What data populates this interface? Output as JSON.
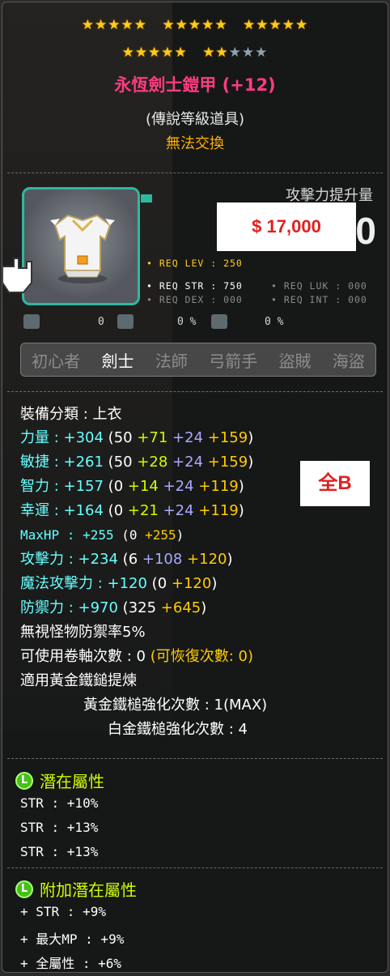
{
  "stars": {
    "row1": [
      "★★★★★",
      "★★★★★",
      "★★★★★"
    ],
    "row2_lit_a": "★★★★★",
    "row2_lit_b": "★★",
    "row2_dim": "★★★"
  },
  "item": {
    "name": "永恆劍士鎧甲 (+12)",
    "grade": "(傳說等級道具)",
    "trade": "無法交換"
  },
  "attack_boost_label": "攻擊力提升量",
  "attack_boost_value": "0",
  "price_label": "$ 17,000",
  "requirements": {
    "lev": "• REQ LEV : 250",
    "str": "• REQ STR : 750",
    "luk": "• REQ LUK : 000",
    "dex": "• REQ DEX : 000",
    "int": "• REQ INT : 000"
  },
  "small_values": [
    "0",
    "0 %",
    "0 %"
  ],
  "jobs": [
    "初心者",
    "劍士",
    "法師",
    "弓箭手",
    "盜賊",
    "海盜"
  ],
  "active_job_index": 1,
  "equip_type": "裝備分類 : 上衣",
  "stats": {
    "str": {
      "label": "力量",
      "total": " : +304",
      "open": " (50 ",
      "a": "+71",
      "b": " +24",
      "c": " +159",
      "close": ")"
    },
    "dex": {
      "label": "敏捷",
      "total": " : +261",
      "open": " (50 ",
      "a": "+28",
      "b": " +24",
      "c": " +159",
      "close": ")"
    },
    "int": {
      "label": "智力",
      "total": " : +157",
      "open": " (0 ",
      "a": "+14",
      "b": " +24",
      "c": " +119",
      "close": ")"
    },
    "luk": {
      "label": "幸運",
      "total": " : +164",
      "open": " (0 ",
      "a": "+21",
      "b": " +24",
      "c": " +119",
      "close": ")"
    },
    "maxhp": {
      "label": "MaxHP",
      "total": " : +255",
      "open": " (0 ",
      "c": "+255",
      "close": ")"
    },
    "atk": {
      "label": "攻擊力",
      "total": " : +234",
      "open": " (6 ",
      "b": "+108",
      "c": " +120",
      "close": ")"
    },
    "matk": {
      "label": "魔法攻擊力",
      "total": " : +120",
      "open": " (0 ",
      "c": "+120",
      "close": ")"
    },
    "def": {
      "label": "防禦力",
      "total": " : +970",
      "open": " (325 ",
      "c": "+645",
      "close": ")"
    }
  },
  "ignore_def": "無視怪物防禦率5%",
  "upgrades_label": "可使用卷軸次數 : 0",
  "upgrades_recover": " (可恢復次數: 0)",
  "hammer_label": "適用黃金鐵鎚提煉",
  "hammer_gold": "黃金鐵槌強化次數 : 1(MAX)",
  "hammer_plat": "白金鐵槌強化次數 : 4",
  "allb_label": "全B",
  "potential": {
    "badge": "L",
    "title": "潛在屬性",
    "lines": [
      "STR : +10%",
      "STR : +13%",
      "STR : +13%"
    ]
  },
  "bonus_potential": {
    "badge": "L",
    "title": "附加潛在屬性",
    "lines": [
      "+ STR : +9%",
      "+ 最大MP : +9%",
      "+ 全屬性 : +6%"
    ]
  }
}
